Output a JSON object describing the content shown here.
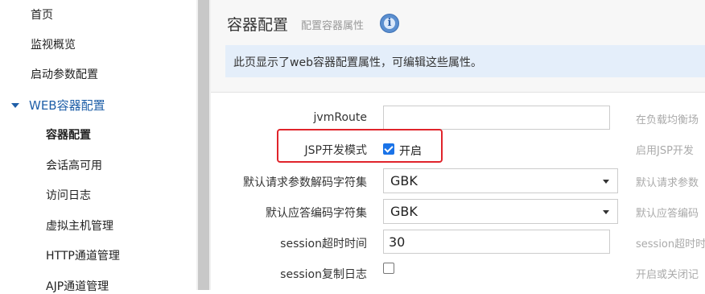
{
  "sidebar": {
    "items": [
      {
        "label": "首页"
      },
      {
        "label": "监视概览"
      },
      {
        "label": "启动参数配置"
      },
      {
        "label": "WEB容器配置"
      },
      {
        "label": "容器配置"
      },
      {
        "label": "会话高可用"
      },
      {
        "label": "访问日志"
      },
      {
        "label": "虚拟主机管理"
      },
      {
        "label": "HTTP通道管理"
      },
      {
        "label": "AJP通道管理"
      }
    ]
  },
  "header": {
    "title": "容器配置",
    "subtitle": "配置容器属性",
    "info_icon": "info-icon"
  },
  "notice": {
    "text": "此页显示了web容器配置属性，可编辑这些属性。"
  },
  "form": {
    "jvm_route": {
      "label": "jvmRoute",
      "value": "",
      "help": "在负载均衡场"
    },
    "jsp_dev": {
      "label": "JSP开发模式",
      "checked": true,
      "check_label": "开启",
      "help": "启用JSP开发"
    },
    "req_encoding": {
      "label": "默认请求参数解码字符集",
      "value": "GBK",
      "help": "默认请求参数"
    },
    "resp_encoding": {
      "label": "默认应答编码字符集",
      "value": "GBK",
      "help": "默认应答编码"
    },
    "session_timeout": {
      "label": "session超时时间",
      "value": "30",
      "help": "session超时时"
    },
    "session_log": {
      "label": "session复制日志",
      "checked": false,
      "help": "开启或关闭记"
    }
  },
  "colors": {
    "highlight": "#e0242b",
    "accent": "#1f5fa8",
    "notice_bg": "#e4eefa"
  }
}
